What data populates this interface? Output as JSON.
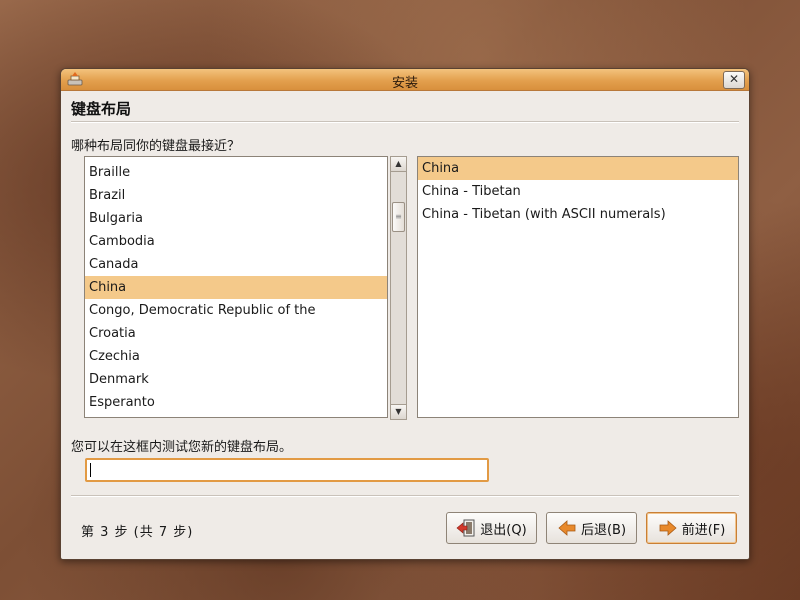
{
  "window": {
    "title": "安装",
    "close_symbol": "✕",
    "title_icon": "installer-icon"
  },
  "page": {
    "heading": "键盘布局",
    "question": "哪种布局同你的键盘最接近？",
    "test_prompt": "您可以在这框内测试您新的键盘布局。",
    "test_value": ""
  },
  "layouts": {
    "items": [
      "Braille",
      "Brazil",
      "Bulgaria",
      "Cambodia",
      "Canada",
      "China",
      "Congo, Democratic Republic of the",
      "Croatia",
      "Czechia",
      "Denmark",
      "Esperanto"
    ],
    "selected": "China"
  },
  "variants": {
    "items": [
      "China",
      "China - Tibetan",
      "China - Tibetan (with ASCII numerals)"
    ],
    "selected": "China"
  },
  "scrollbar": {
    "up_icon": "▲",
    "down_icon": "▼",
    "thumb_grip": "≡"
  },
  "footer": {
    "step": "第 3 步 (共 7 步)",
    "quit_label": "退出(Q)",
    "back_label": "后退(B)",
    "forward_label": "前进(F)"
  },
  "colors": {
    "accent": "#e3a04e",
    "selection": "#f4c98a",
    "arrow_orange": "#e8892b",
    "quit_red": "#d33a2c"
  }
}
